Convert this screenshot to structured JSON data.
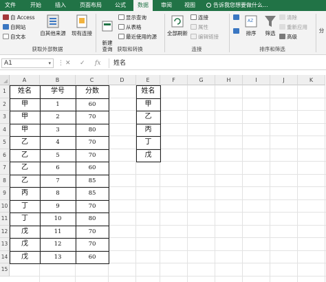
{
  "tabs": [
    {
      "label": "文件",
      "active": false
    },
    {
      "label": "开始",
      "active": false
    },
    {
      "label": "插入",
      "active": false
    },
    {
      "label": "页面布局",
      "active": false
    },
    {
      "label": "公式",
      "active": false
    },
    {
      "label": "数据",
      "active": true
    },
    {
      "label": "审阅",
      "active": false
    },
    {
      "label": "视图",
      "active": false
    }
  ],
  "tellme": "告诉我您想要做什么...",
  "ribbon": {
    "get_external": {
      "access": "自 Access",
      "web": "自网站",
      "text": "自文本",
      "other_sources": "自其他来源",
      "existing": "现有连接",
      "group_label": "获取外部数据"
    },
    "get_transform": {
      "new_query": "新建\n查询",
      "show_queries": "显示查询",
      "from_table": "从表格",
      "recent_sources": "最近使用的源",
      "group_label": "获取和转换"
    },
    "connections": {
      "refresh_all": "全部刷新",
      "connections": "连接",
      "properties": "属性",
      "edit_links": "编辑链接",
      "group_label": "连接"
    },
    "sort_filter": {
      "sort": "排序",
      "filter": "筛选",
      "clear": "清除",
      "reapply": "重新应用",
      "advanced": "高级",
      "group_label": "排序和筛选",
      "cut_label": "分"
    }
  },
  "formula_bar": {
    "name_box": "A1",
    "cancel": "✕",
    "enter": "✓",
    "fx": "fx",
    "content": "姓名"
  },
  "sheet": {
    "columns": [
      "A",
      "B",
      "C",
      "D",
      "E",
      "F",
      "G",
      "H",
      "I",
      "J",
      "K"
    ],
    "rows": [
      "1",
      "2",
      "3",
      "4",
      "5",
      "6",
      "7",
      "8",
      "9",
      "10",
      "11",
      "12",
      "13",
      "14",
      "15"
    ],
    "table_main": {
      "headers": [
        "姓名",
        "学号",
        "分数"
      ],
      "rows": [
        [
          "甲",
          "1",
          "60"
        ],
        [
          "甲",
          "2",
          "70"
        ],
        [
          "甲",
          "3",
          "80"
        ],
        [
          "乙",
          "4",
          "70"
        ],
        [
          "乙",
          "5",
          "70"
        ],
        [
          "乙",
          "6",
          "60"
        ],
        [
          "乙",
          "7",
          "85"
        ],
        [
          "丙",
          "8",
          "85"
        ],
        [
          "丁",
          "9",
          "70"
        ],
        [
          "丁",
          "10",
          "80"
        ],
        [
          "戊",
          "11",
          "70"
        ],
        [
          "戊",
          "12",
          "70"
        ],
        [
          "戊",
          "13",
          "60"
        ]
      ]
    },
    "table_unique": {
      "header": "姓名",
      "rows": [
        "甲",
        "乙",
        "丙",
        "丁",
        "戊"
      ]
    }
  }
}
